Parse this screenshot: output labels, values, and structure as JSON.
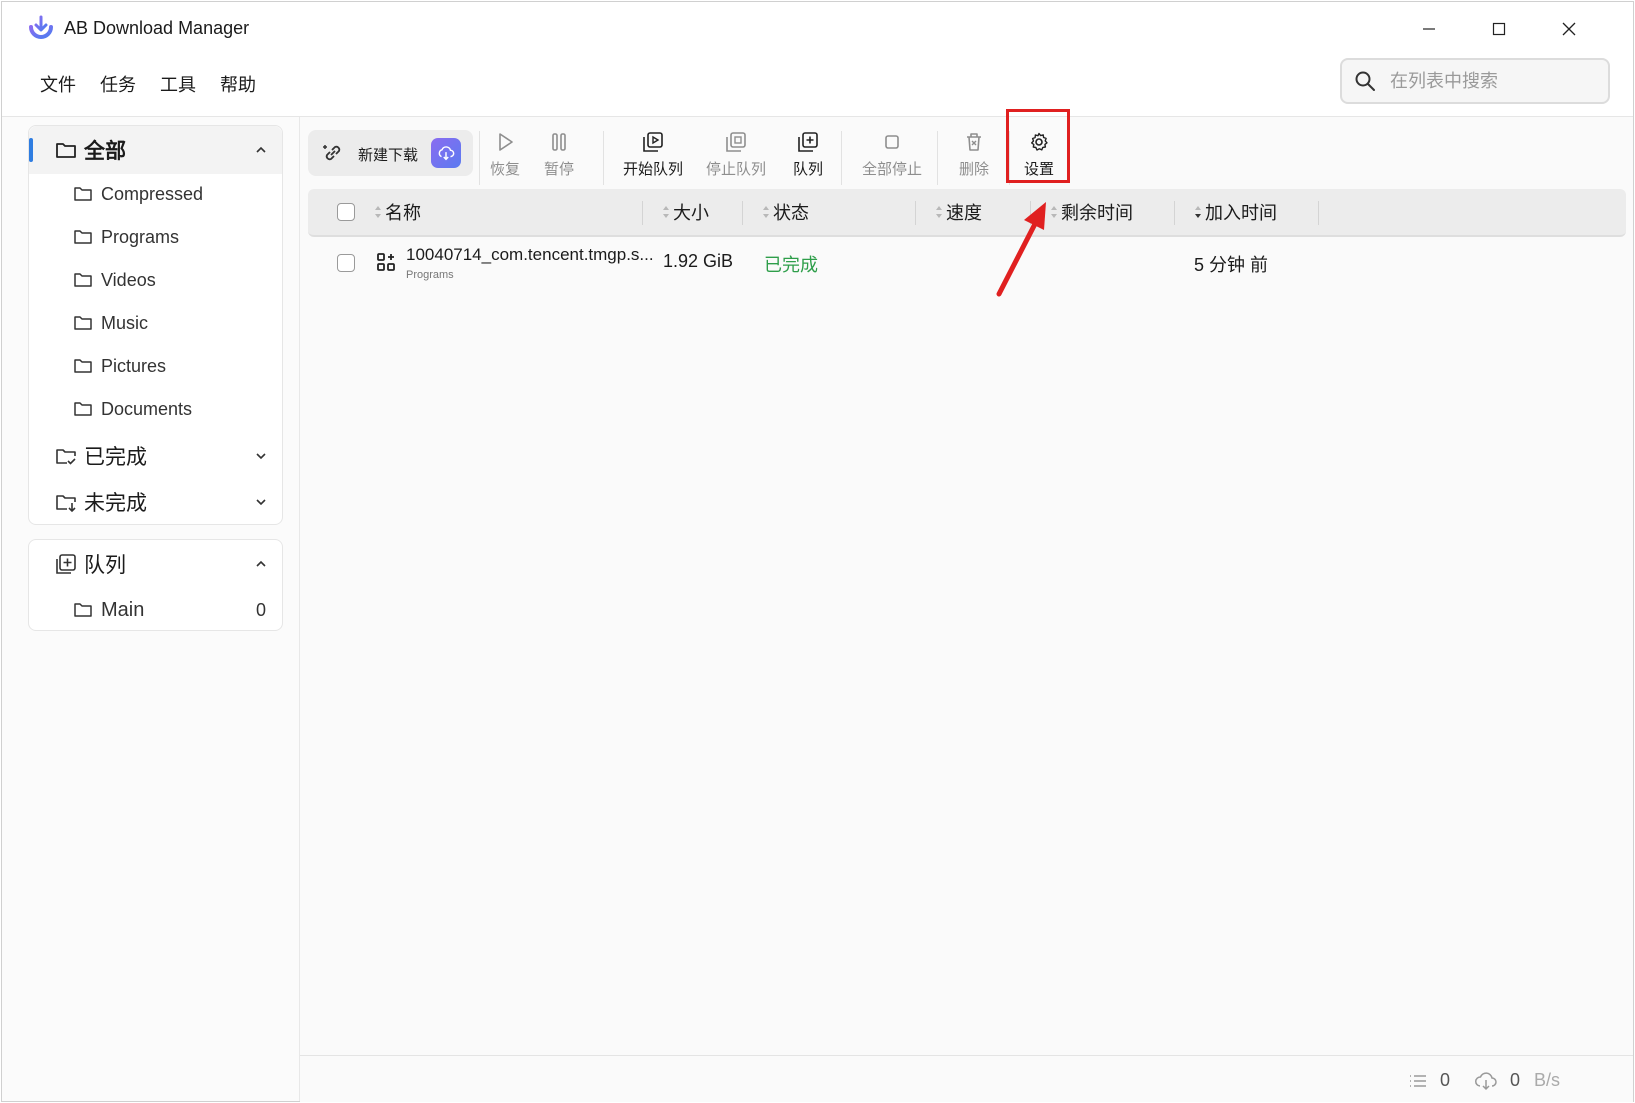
{
  "app": {
    "title": "AB Download Manager"
  },
  "menu": [
    "文件",
    "任务",
    "工具",
    "帮助"
  ],
  "search": {
    "placeholder": "在列表中搜索"
  },
  "sidebar": {
    "all": {
      "label": "全部",
      "folders": [
        "Compressed",
        "Programs",
        "Videos",
        "Music",
        "Pictures",
        "Documents"
      ]
    },
    "completed": {
      "label": "已完成"
    },
    "incomplete": {
      "label": "未完成"
    },
    "queues": {
      "label": "队列",
      "items": [
        {
          "name": "Main",
          "count": "0"
        }
      ]
    }
  },
  "toolbar": {
    "new_download": "新建下载",
    "resume": "恢复",
    "pause": "暂停",
    "start_queue": "开始队列",
    "stop_queue": "停止队列",
    "queue": "队列",
    "stop_all": "全部停止",
    "delete": "删除",
    "settings": "设置"
  },
  "table": {
    "columns": [
      "名称",
      "大小",
      "状态",
      "速度",
      "剩余时间",
      "加入时间"
    ],
    "rows": [
      {
        "name": "10040714_com.tencent.tmgp.s...",
        "category": "Programs",
        "size": "1.92 GiB",
        "status": "已完成",
        "speed": "",
        "remaining": "",
        "added": "5 分钟 前"
      }
    ]
  },
  "footer": {
    "active_count": "0",
    "speed_value": "0",
    "speed_unit": "B/s"
  },
  "colors": {
    "accent": "#2f7de1",
    "status_complete": "#2e9e4a",
    "highlight": "#e02020"
  }
}
